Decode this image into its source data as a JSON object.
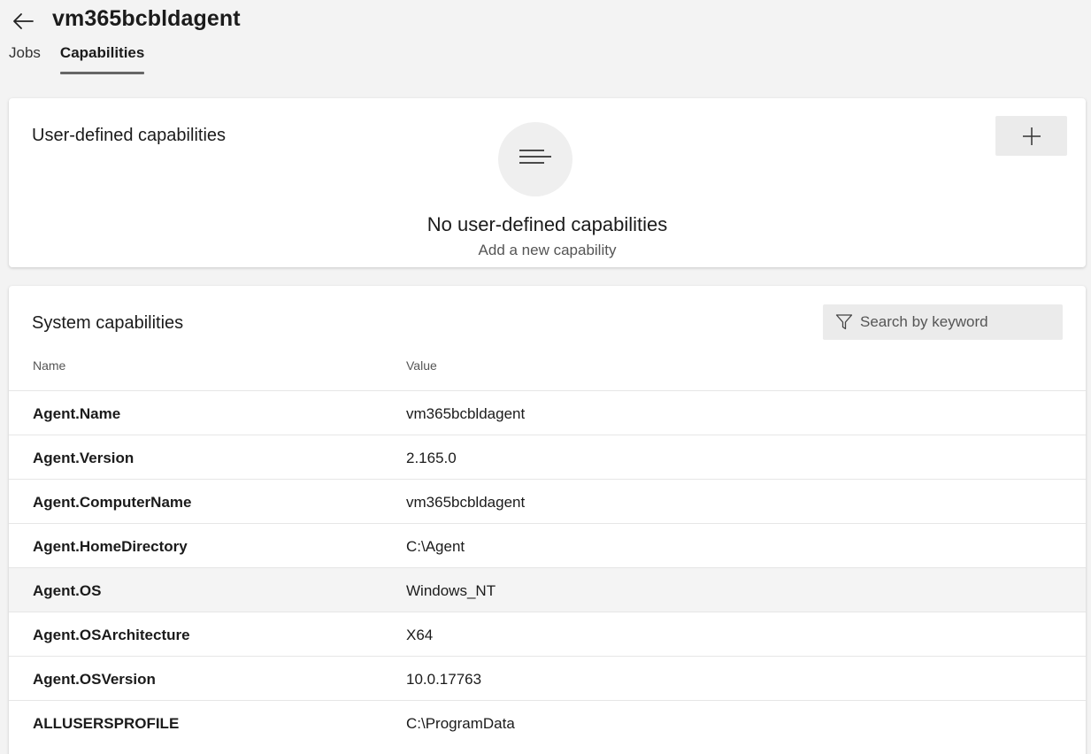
{
  "header": {
    "title": "vm365bcbldagent",
    "tabs": [
      {
        "label": "Jobs",
        "active": false
      },
      {
        "label": "Capabilities",
        "active": true
      }
    ]
  },
  "user_capabilities": {
    "title": "User-defined capabilities",
    "add_button_icon": "plus-icon",
    "empty_title": "No user-defined capabilities",
    "empty_subtitle": "Add a new capability"
  },
  "system_capabilities": {
    "title": "System capabilities",
    "search_placeholder": "Search by keyword",
    "columns": {
      "name": "Name",
      "value": "Value"
    },
    "rows": [
      {
        "name": "Agent.Name",
        "value": "vm365bcbldagent"
      },
      {
        "name": "Agent.Version",
        "value": "2.165.0"
      },
      {
        "name": "Agent.ComputerName",
        "value": "vm365bcbldagent"
      },
      {
        "name": "Agent.HomeDirectory",
        "value": "C:\\Agent"
      },
      {
        "name": "Agent.OS",
        "value": "Windows_NT"
      },
      {
        "name": "Agent.OSArchitecture",
        "value": "X64"
      },
      {
        "name": "Agent.OSVersion",
        "value": "10.0.17763"
      },
      {
        "name": "ALLUSERSPROFILE",
        "value": "C:\\ProgramData"
      }
    ]
  },
  "colors": {
    "background": "#f3f3f3",
    "card": "#ffffff",
    "button_bg": "#ebebeb",
    "row_highlight": "#f4f4f4"
  }
}
